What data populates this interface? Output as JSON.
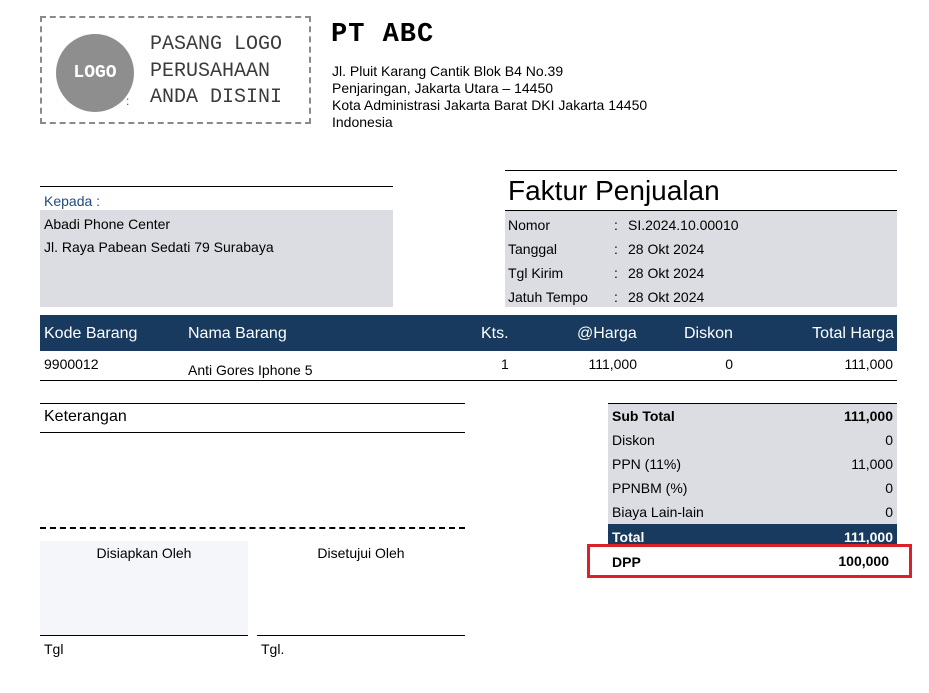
{
  "logo": {
    "circle_text": "LOGO",
    "colon": ":",
    "lines": [
      "PASANG LOGO",
      "PERUSAHAAN",
      "ANDA DISINI"
    ]
  },
  "company": {
    "name": "PT ABC",
    "address": [
      "Jl. Pluit Karang Cantik Blok B4 No.39",
      "Penjaringan, Jakarta Utara – 14450",
      "Kota Administrasi Jakarta Barat DKI Jakarta 14450",
      "Indonesia"
    ]
  },
  "recipient": {
    "label": "Kepada :",
    "name": "Abadi Phone Center",
    "address": "Jl. Raya Pabean Sedati 79 Surabaya"
  },
  "invoice": {
    "title": "Faktur Penjualan",
    "fields": [
      {
        "label": "Nomor",
        "colon": ":",
        "value": "SI.2024.10.00010"
      },
      {
        "label": "Tanggal",
        "colon": ":",
        "value": "28 Okt 2024"
      },
      {
        "label": "Tgl Kirim",
        "colon": ":",
        "value": "28 Okt 2024"
      },
      {
        "label": "Jatuh Tempo",
        "colon": ":",
        "value": "28 Okt 2024"
      }
    ]
  },
  "table": {
    "headers": [
      "Kode Barang",
      "Nama Barang",
      "Kts.",
      "@Harga",
      "Diskon",
      "Total Harga"
    ],
    "rows": [
      [
        "9900012",
        "Anti Gores Iphone 5",
        "1",
        "111,000",
        "0",
        "111,000"
      ]
    ]
  },
  "notes": {
    "label": "Keterangan"
  },
  "signatures": {
    "prepared": "Disiapkan Oleh",
    "approved": "Disetujui Oleh",
    "tgl_left": "Tgl",
    "tgl_right": "Tgl."
  },
  "summary": {
    "rows": [
      {
        "label": "Sub Total",
        "value": "111,000"
      },
      {
        "label": "Diskon",
        "value": "0"
      },
      {
        "label": "PPN (11%)",
        "value": "11,000"
      },
      {
        "label": "PPNBM (%)",
        "value": "0"
      },
      {
        "label": "Biaya Lain-lain",
        "value": "0"
      }
    ],
    "total_label": "Total",
    "total_value": "111,000",
    "dpp_label": "DPP",
    "dpp_value": "100,000"
  },
  "colors": {
    "header_bg": "#173a5e",
    "field_bg": "#dcdde2",
    "highlight": "#dc2027"
  }
}
